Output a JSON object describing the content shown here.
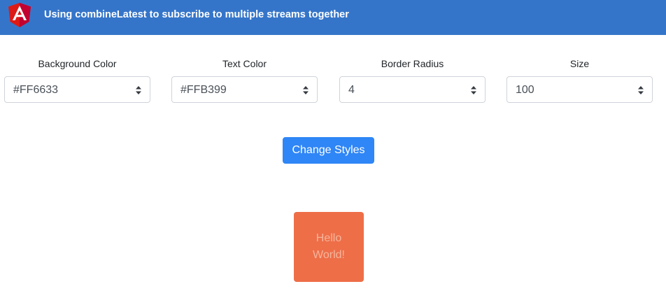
{
  "header": {
    "title": "Using combineLatest to subscribe to multiple streams together",
    "logo_icon": "angular-logo-icon",
    "logo_letter": "A"
  },
  "controls": [
    {
      "label": "Background Color",
      "value": "#FF6633"
    },
    {
      "label": "Text Color",
      "value": "#FFB399"
    },
    {
      "label": "Border Radius",
      "value": "4"
    },
    {
      "label": "Size",
      "value": "100"
    }
  ],
  "button": {
    "label": "Change Styles"
  },
  "preview": {
    "line1": "Hello",
    "line2": "World!"
  },
  "colors": {
    "header_bg": "#3575c9",
    "button_bg": "#2f86f6",
    "preview_bg": "#ee6e48",
    "preview_text": "#f6b59c"
  }
}
